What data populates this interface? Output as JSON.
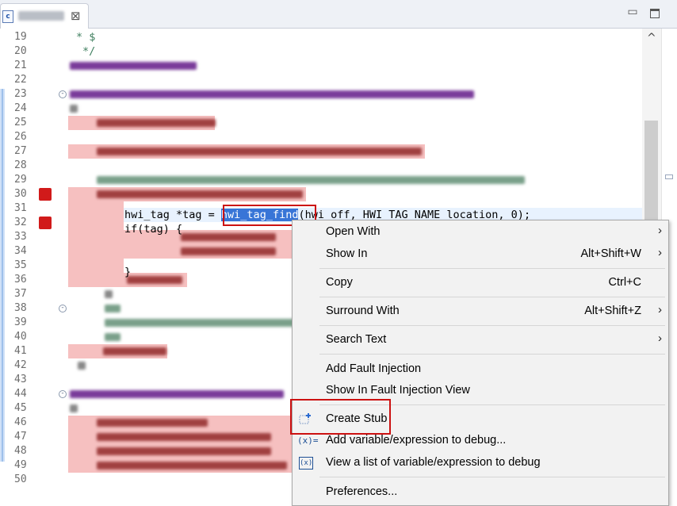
{
  "tab": {
    "file_icon_letter": "c",
    "close_glyph": "⊠",
    "minimize_glyph": "▭",
    "maximize_glyph": ""
  },
  "editor": {
    "line_numbers": [
      "19",
      "20",
      "21",
      "22",
      "23",
      "24",
      "25",
      "26",
      "27",
      "28",
      "29",
      "30",
      "31",
      "32",
      "33",
      "34",
      "35",
      "36",
      "37",
      "38",
      "39",
      "40",
      "41",
      "42",
      "43",
      "44",
      "45",
      "46",
      "47",
      "48",
      "49",
      "50"
    ],
    "comment_line_19": "* $",
    "comment_line_20": "*/",
    "line_31_prefix": "hwi_tag *tag = ",
    "line_31_selection": "hwi_tag_find",
    "line_31_suffix": "(hwi_off, HWI_TAG_NAME_location, 0);",
    "line_32_code": "if(tag) {",
    "line_35_code": "}",
    "breakpoint_lines": [
      "30",
      "32"
    ],
    "fold_lines": [
      "23",
      "38",
      "44"
    ]
  },
  "context_menu": {
    "items": [
      {
        "label": "Open With",
        "shortcut": "",
        "submenu": "›"
      },
      {
        "label": "Show In",
        "shortcut": "Alt+Shift+W",
        "submenu": "›"
      },
      {
        "label": "Copy",
        "shortcut": "Ctrl+C",
        "submenu": ""
      },
      {
        "label": "Surround With",
        "shortcut": "Alt+Shift+Z",
        "submenu": "›"
      },
      {
        "label": "Search Text",
        "shortcut": "",
        "submenu": "›"
      },
      {
        "label": "Add Fault Injection",
        "shortcut": "",
        "submenu": ""
      },
      {
        "label": "Show In Fault Injection View",
        "shortcut": "",
        "submenu": ""
      },
      {
        "label": "Create Stub",
        "shortcut": "",
        "submenu": "",
        "icon": "create-stub-icon"
      },
      {
        "label": "Add variable/expression to debug...",
        "shortcut": "",
        "submenu": "",
        "icon": "add-expression-icon"
      },
      {
        "label": "View a list of variable/expression to debug",
        "shortcut": "",
        "submenu": "",
        "icon": "expression-list-icon"
      },
      {
        "label": "Preferences...",
        "shortcut": "",
        "submenu": ""
      }
    ],
    "icon_glyphs": {
      "add_expression": "(x)=",
      "expression_list": "(x)"
    }
  },
  "scrollbar": {
    "up_glyph": "^"
  },
  "colors": {
    "highlight": "#f6c0c0",
    "breakpoint": "#d11a1a",
    "selection": "#3875d7",
    "annotation_box": "#cc1111",
    "comment": "#3f7f5f"
  }
}
